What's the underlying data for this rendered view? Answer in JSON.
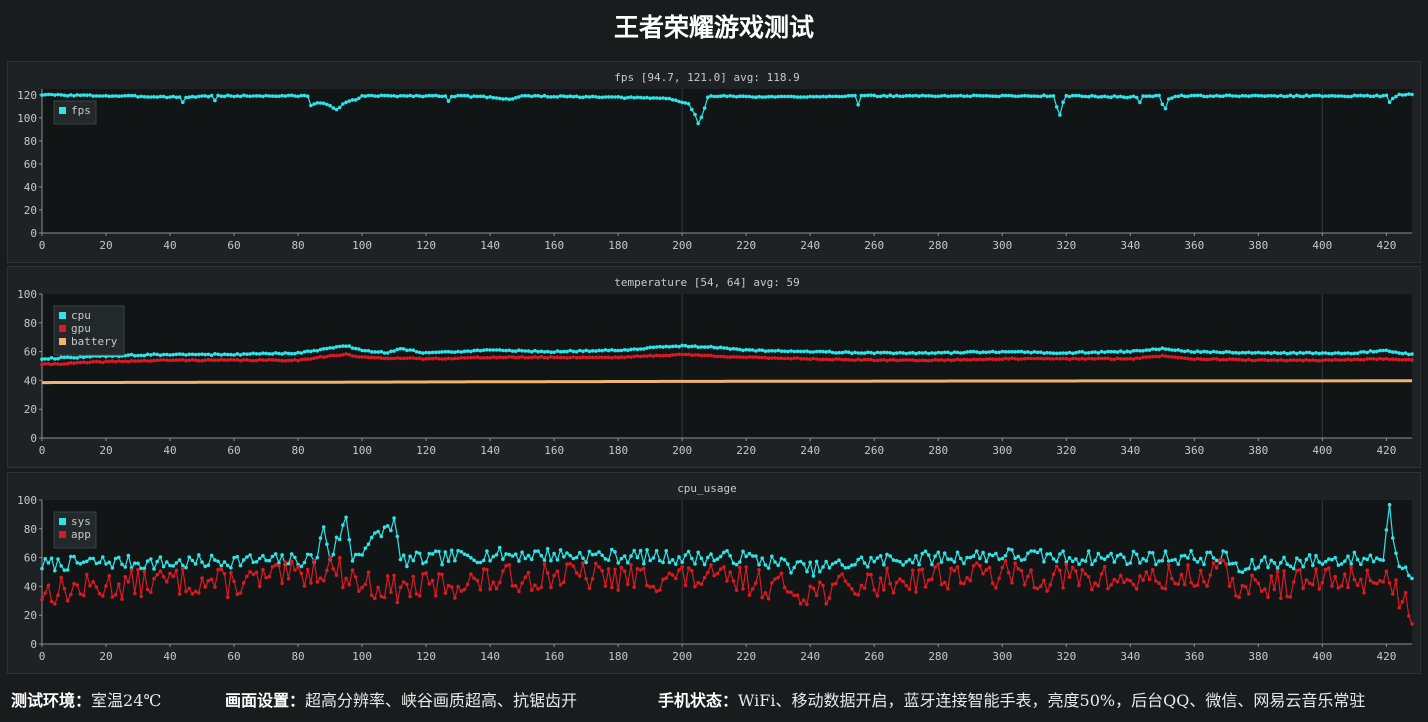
{
  "title": "王者荣耀游戏测试",
  "theme": {
    "background": "#191b1c",
    "panel": "#1e2224",
    "plot": "#121516",
    "grid": "#2b3133",
    "text": "#c8c8c8",
    "cyan": "#2de4e8",
    "red": "#d81a22",
    "orange": "#f2b36a"
  },
  "footer": {
    "env_label": "测试环境：",
    "env_value": "室温24℃",
    "display_label": "画面设置：",
    "display_value": "超高分辨率、峡谷画质超高、抗锯齿开",
    "phone_label": "手机状态：",
    "phone_value": "WiFi、移动数据开启，蓝牙连接智能手表，亮度50%，后台QQ、微信、网易云音乐常驻"
  },
  "chart_data": [
    {
      "type": "line",
      "title": "fps [94.7, 121.0] avg: 118.9",
      "xlim": [
        0,
        428
      ],
      "ylim": [
        0,
        125
      ],
      "x_ticks": [
        0,
        20,
        40,
        60,
        80,
        100,
        120,
        140,
        160,
        180,
        200,
        220,
        240,
        260,
        280,
        300,
        320,
        340,
        360,
        380,
        400,
        420
      ],
      "y_ticks": [
        0,
        20,
        40,
        60,
        80,
        100,
        120
      ],
      "legend_position": "top-left",
      "series": [
        {
          "name": "fps",
          "color": "#2de4e8",
          "baseline": 120,
          "jitter": 0.6,
          "points": [
            [
              0,
              120
            ],
            [
              43,
              118
            ],
            [
              44,
              113
            ],
            [
              45,
              118
            ],
            [
              53,
              119
            ],
            [
              54,
              115
            ],
            [
              55,
              119
            ],
            [
              83,
              119
            ],
            [
              84,
              111
            ],
            [
              86,
              113
            ],
            [
              90,
              111
            ],
            [
              92,
              107
            ],
            [
              94,
              112
            ],
            [
              99,
              117
            ],
            [
              100,
              119
            ],
            [
              126,
              119
            ],
            [
              127,
              115
            ],
            [
              128,
              119
            ],
            [
              140,
              118
            ],
            [
              146,
              116
            ],
            [
              150,
              119
            ],
            [
              195,
              117
            ],
            [
              198,
              115
            ],
            [
              202,
              112
            ],
            [
              204,
              103
            ],
            [
              205,
              95
            ],
            [
              206,
              100
            ],
            [
              208,
              118
            ],
            [
              210,
              119
            ],
            [
              226,
              118
            ],
            [
              254,
              119
            ],
            [
              255,
              111
            ],
            [
              256,
              119
            ],
            [
              316,
              119
            ],
            [
              317,
              110
            ],
            [
              318,
              103
            ],
            [
              319,
              114
            ],
            [
              320,
              119
            ],
            [
              342,
              118
            ],
            [
              343,
              113
            ],
            [
              344,
              119
            ],
            [
              349,
              119
            ],
            [
              350,
              112
            ],
            [
              351,
              108
            ],
            [
              352,
              116
            ],
            [
              354,
              119
            ],
            [
              420,
              119
            ],
            [
              421,
              114
            ],
            [
              422,
              117
            ],
            [
              424,
              120
            ],
            [
              428,
              120
            ]
          ]
        }
      ]
    },
    {
      "type": "line",
      "title": "temperature [54, 64] avg: 59",
      "xlim": [
        0,
        428
      ],
      "ylim": [
        0,
        100
      ],
      "x_ticks": [
        0,
        20,
        40,
        60,
        80,
        100,
        120,
        140,
        160,
        180,
        200,
        220,
        240,
        260,
        280,
        300,
        320,
        340,
        360,
        380,
        400,
        420
      ],
      "y_ticks": [
        0,
        20,
        40,
        60,
        80,
        100
      ],
      "legend_position": "top-left",
      "series": [
        {
          "name": "cpu",
          "color": "#2de4e8",
          "jitter": 0.5,
          "points": [
            [
              0,
              55
            ],
            [
              10,
              56
            ],
            [
              20,
              57
            ],
            [
              40,
              58
            ],
            [
              60,
              58
            ],
            [
              80,
              59
            ],
            [
              86,
              61
            ],
            [
              95,
              64
            ],
            [
              100,
              61
            ],
            [
              108,
              59
            ],
            [
              112,
              62
            ],
            [
              120,
              59
            ],
            [
              140,
              61
            ],
            [
              160,
              60
            ],
            [
              180,
              61
            ],
            [
              200,
              64
            ],
            [
              210,
              63
            ],
            [
              220,
              61
            ],
            [
              240,
              60
            ],
            [
              260,
              59
            ],
            [
              280,
              59
            ],
            [
              300,
              60
            ],
            [
              316,
              59
            ],
            [
              340,
              60
            ],
            [
              350,
              62
            ],
            [
              360,
              60
            ],
            [
              380,
              59
            ],
            [
              400,
              59
            ],
            [
              410,
              59
            ],
            [
              420,
              61
            ],
            [
              424,
              59
            ],
            [
              428,
              58
            ]
          ]
        },
        {
          "name": "gpu",
          "color": "#d81a22",
          "jitter": 0.4,
          "points": [
            [
              0,
              51
            ],
            [
              10,
              52
            ],
            [
              20,
              53
            ],
            [
              40,
              54
            ],
            [
              60,
              54
            ],
            [
              80,
              54
            ],
            [
              86,
              56
            ],
            [
              95,
              58
            ],
            [
              100,
              56
            ],
            [
              120,
              55
            ],
            [
              140,
              56
            ],
            [
              160,
              56
            ],
            [
              180,
              56
            ],
            [
              200,
              58
            ],
            [
              210,
              57
            ],
            [
              220,
              56
            ],
            [
              240,
              55
            ],
            [
              260,
              54
            ],
            [
              280,
              54
            ],
            [
              300,
              55
            ],
            [
              340,
              55
            ],
            [
              350,
              57
            ],
            [
              360,
              55
            ],
            [
              380,
              54
            ],
            [
              400,
              54
            ],
            [
              420,
              55
            ],
            [
              428,
              54
            ]
          ]
        },
        {
          "name": "battery",
          "color": "#f2b36a",
          "jitter": 0,
          "points": [
            [
              0,
              38.5
            ],
            [
              100,
              38.8
            ],
            [
              150,
              39.1
            ],
            [
              200,
              39.3
            ],
            [
              300,
              39.6
            ],
            [
              428,
              39.7
            ]
          ]
        }
      ]
    },
    {
      "type": "line",
      "title": "cpu_usage",
      "xlim": [
        0,
        428
      ],
      "ylim": [
        0,
        100
      ],
      "x_ticks": [
        0,
        20,
        40,
        60,
        80,
        100,
        120,
        140,
        160,
        180,
        200,
        220,
        240,
        260,
        280,
        300,
        320,
        340,
        360,
        380,
        400,
        420
      ],
      "y_ticks": [
        0,
        20,
        40,
        60,
        80,
        100
      ],
      "legend_position": "top-left",
      "series": [
        {
          "name": "sys",
          "color": "#2de4e8",
          "jitter": 5,
          "seed": 7,
          "points": [
            [
              0,
              55
            ],
            [
              20,
              57
            ],
            [
              40,
              56
            ],
            [
              60,
              58
            ],
            [
              80,
              58
            ],
            [
              86,
              60
            ],
            [
              88,
              82
            ],
            [
              90,
              60
            ],
            [
              95,
              86
            ],
            [
              97,
              60
            ],
            [
              110,
              85
            ],
            [
              112,
              58
            ],
            [
              140,
              62
            ],
            [
              160,
              62
            ],
            [
              180,
              61
            ],
            [
              200,
              60
            ],
            [
              220,
              60
            ],
            [
              240,
              52
            ],
            [
              260,
              58
            ],
            [
              280,
              60
            ],
            [
              300,
              62
            ],
            [
              320,
              60
            ],
            [
              340,
              60
            ],
            [
              360,
              60
            ],
            [
              370,
              60
            ],
            [
              375,
              50
            ],
            [
              380,
              56
            ],
            [
              400,
              58
            ],
            [
              419,
              60
            ],
            [
              421,
              95
            ],
            [
              423,
              60
            ],
            [
              428,
              50
            ]
          ]
        },
        {
          "name": "app",
          "color": "#d81a22",
          "jitter": 10,
          "seed": 13,
          "points": [
            [
              0,
              36
            ],
            [
              20,
              40
            ],
            [
              40,
              44
            ],
            [
              60,
              42
            ],
            [
              80,
              48
            ],
            [
              90,
              54
            ],
            [
              100,
              42
            ],
            [
              110,
              38
            ],
            [
              120,
              40
            ],
            [
              140,
              44
            ],
            [
              160,
              48
            ],
            [
              180,
              46
            ],
            [
              200,
              46
            ],
            [
              220,
              44
            ],
            [
              240,
              36
            ],
            [
              260,
              42
            ],
            [
              280,
              48
            ],
            [
              300,
              48
            ],
            [
              320,
              46
            ],
            [
              340,
              44
            ],
            [
              360,
              46
            ],
            [
              370,
              50
            ],
            [
              375,
              36
            ],
            [
              380,
              40
            ],
            [
              400,
              44
            ],
            [
              420,
              46
            ],
            [
              428,
              22
            ]
          ]
        }
      ]
    }
  ]
}
